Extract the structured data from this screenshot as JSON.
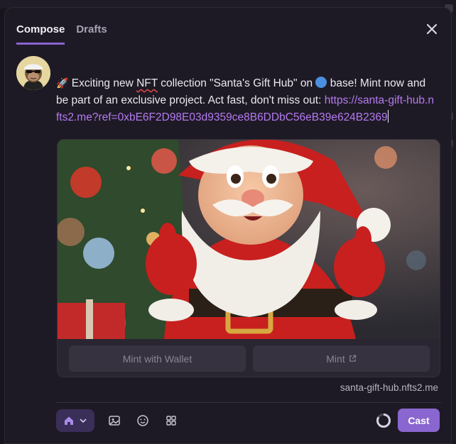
{
  "tabs": [
    {
      "label": "Compose",
      "active": true
    },
    {
      "label": "Drafts",
      "active": false
    }
  ],
  "icons": {
    "close": "close-icon",
    "rocket": "rocket-icon",
    "globe": "globe-icon",
    "home": "home-icon",
    "chevron": "chevron-down-icon",
    "image": "image-icon",
    "emoji": "emoji-icon",
    "apps": "apps-grid-icon",
    "external": "external-link-icon"
  },
  "post": {
    "text_part1": " Exciting new ",
    "text_nft": "NFT",
    "text_part2": " collection \"Santa's Gift Hub\" on ",
    "text_part3": " base! Mint now and be part of an exclusive project. Act fast, don't miss out: ",
    "link": "https://santa-gift-hub.nfts2.me?ref=0xbE6F2D98E03d9359ce8B6DDbC56eB39e624B2369"
  },
  "embed": {
    "button_wallet": "Mint with Wallet",
    "button_mint": "Mint",
    "domain": "santa-gift-hub.nfts2.me"
  },
  "toolbar": {
    "cast_label": "Cast"
  },
  "colors": {
    "accent": "#8a63d2",
    "link": "#b47af0",
    "cast_button": "#8966d0",
    "background": "#1e1a25"
  }
}
